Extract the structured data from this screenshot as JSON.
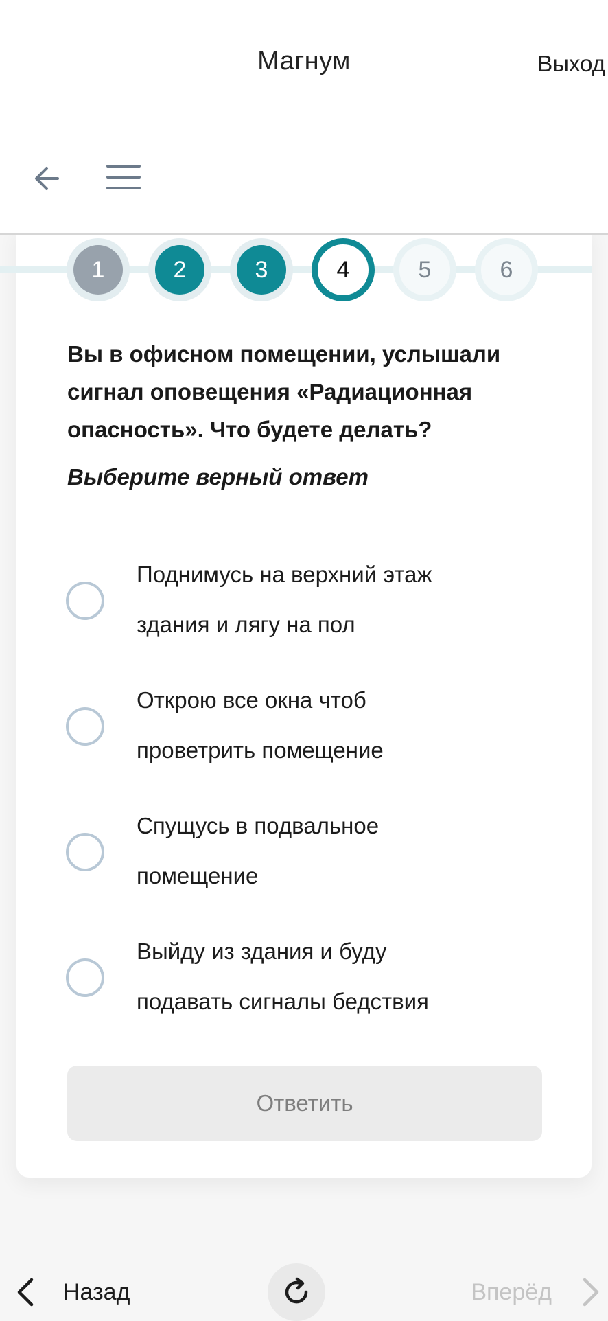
{
  "header": {
    "title": "Магнум",
    "logout_label": "Выход"
  },
  "steps": [
    {
      "label": "1",
      "state": "done-gray"
    },
    {
      "label": "2",
      "state": "done-teal"
    },
    {
      "label": "3",
      "state": "done-teal"
    },
    {
      "label": "4",
      "state": "current"
    },
    {
      "label": "5",
      "state": "pending"
    },
    {
      "label": "6",
      "state": "pending"
    }
  ],
  "quiz": {
    "question": "Вы в офисном помещении, услышали сигнал оповещения «Радиационная опасность». Что будете делать?",
    "hint": "Выберите верный ответ",
    "options": [
      {
        "line1": "Поднимусь на верхний этаж",
        "line2": "здания и лягу на пол"
      },
      {
        "line1": "Открою все окна чтоб",
        "line2": "проветрить помещение"
      },
      {
        "line1": "Спущусь в подвальное",
        "line2": "помещение"
      },
      {
        "line1": "Выйду из здания и буду",
        "line2": "подавать сигналы бедствия"
      }
    ],
    "answer_label": "Ответить"
  },
  "bottom_nav": {
    "back_label": "Назад",
    "forward_label": "Вперёд"
  },
  "colors": {
    "accent": "#0f8a95",
    "step_done_gray": "#98a2ac",
    "radio_border": "#b8c8d6",
    "disabled_button": "#ebebeb"
  }
}
